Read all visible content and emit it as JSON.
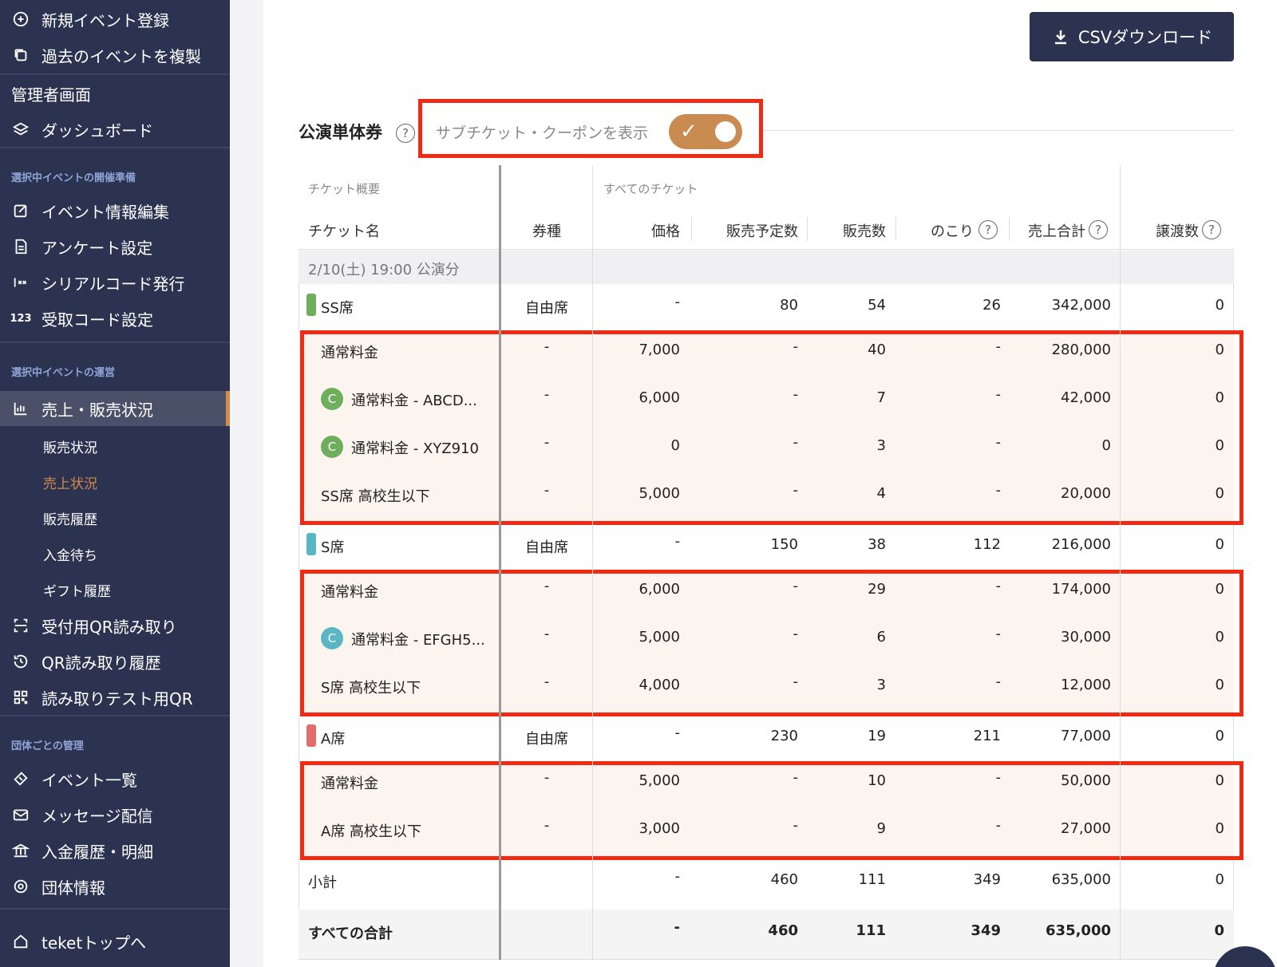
{
  "sidebar": {
    "top_items": [
      {
        "label": "新規イベント登録",
        "icon": "plus-circle-icon"
      },
      {
        "label": "過去のイベントを複製",
        "icon": "copy-icon"
      }
    ],
    "admin_label": "管理者画面",
    "dashboard_label": "ダッシュボード",
    "section_prep": "選択中イベントの開催準備",
    "prep_items": [
      {
        "label": "イベント情報編集",
        "icon": "edit-icon"
      },
      {
        "label": "アンケート設定",
        "icon": "document-icon"
      },
      {
        "label": "シリアルコード発行",
        "icon": "serial-icon"
      },
      {
        "label": "受取コード設定",
        "icon": "123-icon"
      }
    ],
    "icon_123_text": "123",
    "section_ops": "選択中イベントの運営",
    "sales_label": "売上・販売状況",
    "sales_sub": [
      "販売状況",
      "売上状況",
      "販売履歴",
      "入金待ち",
      "ギフト履歴"
    ],
    "ops_items": [
      {
        "label": "受付用QR読み取り",
        "icon": "qr-scan-icon"
      },
      {
        "label": "QR読み取り履歴",
        "icon": "history-icon"
      },
      {
        "label": "読み取りテスト用QR",
        "icon": "qr-code-icon"
      }
    ],
    "section_org": "団体ごとの管理",
    "org_items": [
      {
        "label": "イベント一覧",
        "icon": "ticket-icon"
      },
      {
        "label": "メッセージ配信",
        "icon": "mail-icon"
      },
      {
        "label": "入金履歴・明細",
        "icon": "bank-icon"
      },
      {
        "label": "団体情報",
        "icon": "gear-icon"
      }
    ],
    "bottom_label": "teketトップへ"
  },
  "main": {
    "csv_button": "CSVダウンロード",
    "section_title": "公演単体券",
    "help": "?",
    "toggle_label": "サブチケット・クーポンを表示",
    "toggle_on": true,
    "accent_color": "#c98b50",
    "highlight_color": "#ef2b16"
  },
  "table": {
    "group_overview": "チケット概要",
    "group_all": "すべてのチケット",
    "headers": {
      "name": "チケット名",
      "type": "券種",
      "price": "価格",
      "planned": "販売予定数",
      "sold": "販売数",
      "remaining": "のこり",
      "revenue": "売上合計",
      "transfer": "譲渡数"
    },
    "date_row": "2/10(土) 19:00 公演分",
    "rows": [
      {
        "kind": "main",
        "color": "#6fae5c",
        "name": "SS席",
        "type": "自由席",
        "price": "-",
        "planned": "80",
        "sold": "54",
        "remaining": "26",
        "revenue": "342,000",
        "transfer": "0"
      },
      {
        "kind": "sub",
        "name": "通常料金",
        "type": "-",
        "price": "7,000",
        "planned": "-",
        "sold": "40",
        "remaining": "-",
        "revenue": "280,000",
        "transfer": "0"
      },
      {
        "kind": "sub",
        "coupon": "C",
        "coupon_color": "#6fae5c",
        "name": "通常料金 - ABCD...",
        "type": "-",
        "price": "6,000",
        "planned": "-",
        "sold": "7",
        "remaining": "-",
        "revenue": "42,000",
        "transfer": "0"
      },
      {
        "kind": "sub",
        "coupon": "C",
        "coupon_color": "#6fae5c",
        "name": "通常料金 - XYZ910",
        "type": "-",
        "price": "0",
        "planned": "-",
        "sold": "3",
        "remaining": "-",
        "revenue": "0",
        "transfer": "0"
      },
      {
        "kind": "sub",
        "name": "SS席 高校生以下",
        "type": "-",
        "price": "5,000",
        "planned": "-",
        "sold": "4",
        "remaining": "-",
        "revenue": "20,000",
        "transfer": "0"
      },
      {
        "kind": "main",
        "color": "#5bb6c4",
        "name": "S席",
        "type": "自由席",
        "price": "-",
        "planned": "150",
        "sold": "38",
        "remaining": "112",
        "revenue": "216,000",
        "transfer": "0"
      },
      {
        "kind": "sub",
        "name": "通常料金",
        "type": "-",
        "price": "6,000",
        "planned": "-",
        "sold": "29",
        "remaining": "-",
        "revenue": "174,000",
        "transfer": "0"
      },
      {
        "kind": "sub",
        "coupon": "C",
        "coupon_color": "#5bb6c4",
        "name": "通常料金 - EFGH5...",
        "type": "-",
        "price": "5,000",
        "planned": "-",
        "sold": "6",
        "remaining": "-",
        "revenue": "30,000",
        "transfer": "0"
      },
      {
        "kind": "sub",
        "name": "S席 高校生以下",
        "type": "-",
        "price": "4,000",
        "planned": "-",
        "sold": "3",
        "remaining": "-",
        "revenue": "12,000",
        "transfer": "0"
      },
      {
        "kind": "main",
        "color": "#e06c6c",
        "name": "A席",
        "type": "自由席",
        "price": "-",
        "planned": "230",
        "sold": "19",
        "remaining": "211",
        "revenue": "77,000",
        "transfer": "0"
      },
      {
        "kind": "sub",
        "name": "通常料金",
        "type": "-",
        "price": "5,000",
        "planned": "-",
        "sold": "10",
        "remaining": "-",
        "revenue": "50,000",
        "transfer": "0"
      },
      {
        "kind": "sub",
        "name": "A席 高校生以下",
        "type": "-",
        "price": "3,000",
        "planned": "-",
        "sold": "9",
        "remaining": "-",
        "revenue": "27,000",
        "transfer": "0"
      }
    ],
    "subtotal": {
      "name": "小計",
      "type": "",
      "price": "-",
      "planned": "460",
      "sold": "111",
      "remaining": "349",
      "revenue": "635,000",
      "transfer": "0"
    },
    "total": {
      "name": "すべての合計",
      "type": "",
      "price": "-",
      "planned": "460",
      "sold": "111",
      "remaining": "349",
      "revenue": "635,000",
      "transfer": "0"
    }
  }
}
